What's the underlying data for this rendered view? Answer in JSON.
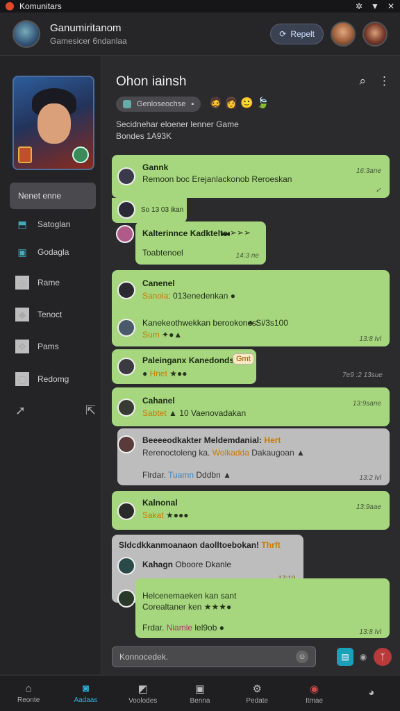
{
  "statusbar": {
    "app_name": "Komunitars"
  },
  "header": {
    "title": "Ganumiritanom",
    "subtitle": "Gamesicer 6ndanlaa",
    "repeat_label": "Repelt"
  },
  "sidebar": {
    "active_item": "Nenet enne",
    "items": [
      {
        "label": "Satoglan",
        "icon": "chat-icon"
      },
      {
        "label": "Godagla",
        "icon": "document-icon"
      },
      {
        "label": "Rame",
        "icon": "search-icon"
      },
      {
        "label": "Tenoct",
        "icon": "tag-icon"
      },
      {
        "label": "Pams",
        "icon": "gamepad-icon"
      },
      {
        "label": "Redomg",
        "icon": "screen-icon"
      }
    ]
  },
  "chat": {
    "title": "Ohon iainsh",
    "game_pill": "Genloseochse",
    "description_line1": "Secidnehar eloener  lenner  Game",
    "description_line2": "Bondes  1A93K"
  },
  "messages": [
    {
      "name": "Gannk",
      "text": "Remoon boc Erejanlackonob  Reroeskan",
      "time": "16:3ane"
    },
    {
      "text": "So  13 03 ikan"
    },
    {
      "name": "Kalterinnce Kadktelte:",
      "text": "Toabtenoel",
      "time": "14:3 ne"
    },
    {
      "name": "Canenel",
      "text_hl": "Sanola:",
      "text": " 013enedenkan",
      "name2": "Kanekeothwekkan berookones:",
      "text2": " Si/3s100",
      "text2_hl": "Sum",
      "time": "13:8 lvl"
    },
    {
      "name": "Paleinganx Kanedonds:",
      "tag": "Gmt",
      "text_hl": "Hnet",
      "time": "7e9 :2 13sue"
    },
    {
      "name": "Cahanel",
      "text_hl": "Sabtet",
      "text": "  10  Vaenovadakan",
      "time": "13:9sane"
    },
    {
      "name": "Beeeeodkakter Meldemdanial:",
      "tag_hl": "Hert",
      "text": "Rerenoctoleng ka.",
      "text_hl": "Wolkadda",
      "text_b": "Dakaugoan",
      "footer": "Flrdar.",
      "footer_hl": "Tuamn",
      "footer_b": "Dddbn",
      "time": "13:2 lvl"
    },
    {
      "name": "Kalnonal",
      "text_hl": "Sakat",
      "time": "13:9aae"
    },
    {
      "name": "Sldcdkkanmoanaon daolltoebokan!",
      "tag_hl": "Thrft"
    },
    {
      "name": "Kahagn",
      "text": " Oboore Dkanle",
      "time": "17:19"
    },
    {
      "text": "Helcenemaeken kan  sant",
      "text2": "Corealtaner ken",
      "footer": "Frdar.",
      "footer_hl": "Niamle",
      "footer_b": " lel9ob",
      "time": "13:8 lvl"
    }
  ],
  "composer": {
    "placeholder": "Konnocedek."
  },
  "bottom_tabs": [
    "Reonte",
    "Aadaas",
    "Voolodes",
    "Benna",
    "Pedate",
    "Itmae",
    ""
  ]
}
